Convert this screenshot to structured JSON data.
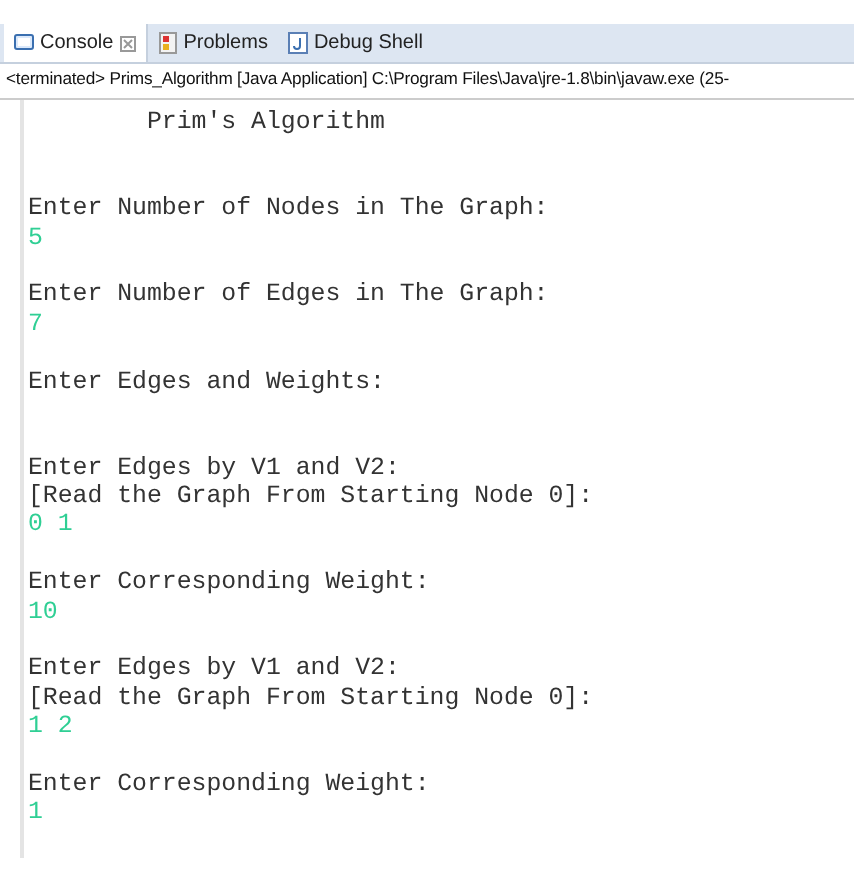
{
  "tabs": [
    {
      "label": "Console",
      "kind": "console",
      "selected": true,
      "closable": true
    },
    {
      "label": "Problems",
      "kind": "problems",
      "selected": false,
      "closable": false
    },
    {
      "label": "Debug Shell",
      "kind": "debug",
      "selected": false,
      "closable": false
    }
  ],
  "status": "<terminated> Prims_Algorithm [Java Application] C:\\Program Files\\Java\\jre-1.8\\bin\\javaw.exe (25-",
  "lines": [
    {
      "kind": "output",
      "text": "        Prim's Algorithm"
    },
    {
      "kind": "blank"
    },
    {
      "kind": "blank"
    },
    {
      "kind": "output",
      "text": "Enter Number of Nodes in The Graph:"
    },
    {
      "kind": "input",
      "text": "5"
    },
    {
      "kind": "blank"
    },
    {
      "kind": "output",
      "text": "Enter Number of Edges in The Graph:"
    },
    {
      "kind": "input",
      "text": "7"
    },
    {
      "kind": "blank"
    },
    {
      "kind": "output",
      "text": "Enter Edges and Weights:"
    },
    {
      "kind": "blank"
    },
    {
      "kind": "blank"
    },
    {
      "kind": "output",
      "text": "Enter Edges by V1 and V2:"
    },
    {
      "kind": "output",
      "text": "[Read the Graph From Starting Node 0]:"
    },
    {
      "kind": "input",
      "text": "0 1"
    },
    {
      "kind": "blank"
    },
    {
      "kind": "output",
      "text": "Enter Corresponding Weight:"
    },
    {
      "kind": "input",
      "text": "10"
    },
    {
      "kind": "blank"
    },
    {
      "kind": "output",
      "text": "Enter Edges by V1 and V2:"
    },
    {
      "kind": "output",
      "text": "[Read the Graph From Starting Node 0]:"
    },
    {
      "kind": "input",
      "text": "1 2"
    },
    {
      "kind": "blank"
    },
    {
      "kind": "output",
      "text": "Enter Corresponding Weight:"
    },
    {
      "kind": "input",
      "text": "1"
    }
  ]
}
